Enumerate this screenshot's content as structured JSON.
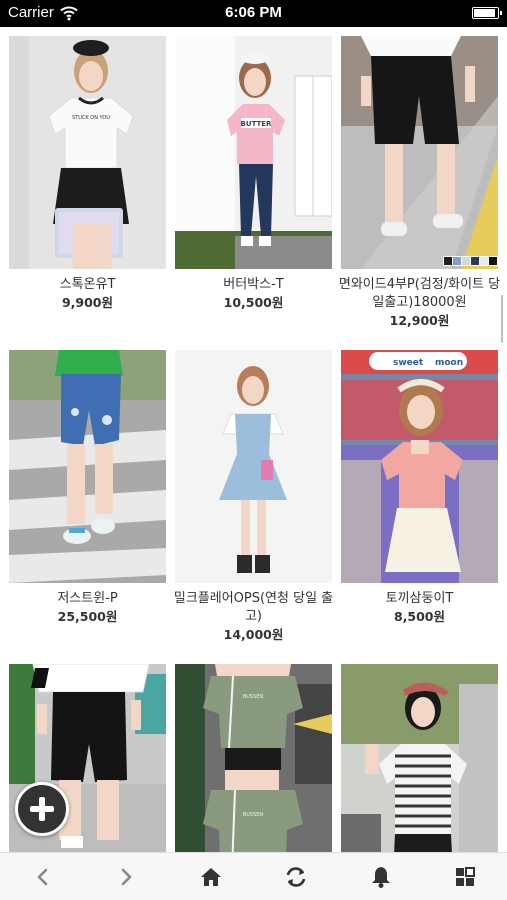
{
  "status_bar": {
    "carrier": "Carrier",
    "time": "6:06 PM",
    "battery_level": 0.9
  },
  "products": [
    {
      "name": "스톡온유T",
      "price": "9,900원"
    },
    {
      "name": "버터박스-T",
      "price": "10,500원"
    },
    {
      "name": "면와이드4부P(검정/화이트 당일출고)18000원",
      "price": "12,900원"
    },
    {
      "name": "저스트윈-P",
      "price": "25,500원"
    },
    {
      "name": "밀크플레어OPS(연청 당일 출고)",
      "price": "14,000원"
    },
    {
      "name": "토끼삼둥이T",
      "price": "8,500원"
    },
    {
      "name": "",
      "price": ""
    },
    {
      "name": "",
      "price": ""
    },
    {
      "name": "",
      "price": ""
    }
  ],
  "photo_texts": {
    "tee_print": "STUCK ON YOU",
    "butter_print": "BUTTER",
    "store_sign_1": "sweet",
    "store_sign_2": "moon",
    "shirt_print": "BUSSEN"
  },
  "color_swatches": [
    "#1f1f1f",
    "#7fa0c8",
    "#d8d8d8",
    "#2e3a55",
    "#e9e9e9",
    "#111111"
  ],
  "fab": {
    "icon": "plus-icon"
  },
  "toolbar": {
    "icons": [
      "back-icon",
      "forward-icon",
      "home-icon",
      "refresh-icon",
      "bell-icon",
      "grid-menu-icon"
    ]
  },
  "colors": {
    "text": "#333333",
    "status_bar": "#000000",
    "toolbar_bg": "#f7f7f7",
    "toolbar_icon": "#333333",
    "toolbar_icon_disabled": "#8a8a8a"
  }
}
